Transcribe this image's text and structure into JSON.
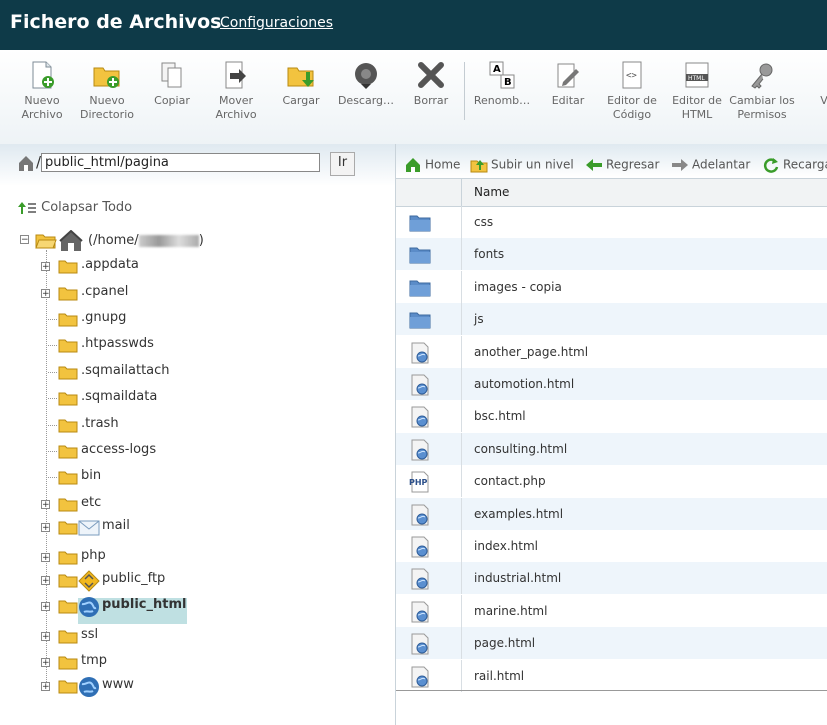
{
  "header": {
    "title": "Fichero de Archivos",
    "config_link": "Configuraciones"
  },
  "toolbar": {
    "new_file": "Nuevo Archivo",
    "new_dir": "Nuevo Directorio",
    "copy": "Copiar",
    "move": "Mover Archivo",
    "upload": "Cargar",
    "download": "Descarg…",
    "delete": "Borrar",
    "rename": "Renomb…",
    "edit": "Editar",
    "code_editor": "Editor de Código",
    "html_editor": "Editor de HTML",
    "permissions": "Cambiar los Permisos",
    "view": "Ve"
  },
  "path": {
    "value": "public_html/pagina",
    "go_label": "Ir"
  },
  "tree": {
    "collapse_label": "Colapsar Todo",
    "root_label": "(/home/",
    "root_label_end": ")",
    "items": [
      {
        "label": ".appdata"
      },
      {
        "label": ".cpanel"
      },
      {
        "label": ".gnupg"
      },
      {
        "label": ".htpasswds"
      },
      {
        "label": ".sqmailattach"
      },
      {
        "label": ".sqmaildata"
      },
      {
        "label": ".trash"
      },
      {
        "label": "access-logs"
      },
      {
        "label": "bin"
      },
      {
        "label": "etc"
      },
      {
        "label": "mail"
      },
      {
        "label": "php"
      },
      {
        "label": "public_ftp"
      },
      {
        "label": "public_html"
      },
      {
        "label": "ssl"
      },
      {
        "label": "tmp"
      },
      {
        "label": "www"
      }
    ]
  },
  "nav": {
    "home": "Home",
    "up": "Subir un nivel",
    "back": "Regresar",
    "forward": "Adelantar",
    "reload": "Recarga"
  },
  "files": {
    "header_name": "Name",
    "rows": [
      {
        "name": "css",
        "icon": "folder-icon"
      },
      {
        "name": "fonts",
        "icon": "folder-icon"
      },
      {
        "name": "images - copia",
        "icon": "folder-icon"
      },
      {
        "name": "js",
        "icon": "folder-icon"
      },
      {
        "name": "another_page.html",
        "icon": "html-file-icon"
      },
      {
        "name": "automotion.html",
        "icon": "html-file-icon"
      },
      {
        "name": "bsc.html",
        "icon": "html-file-icon"
      },
      {
        "name": "consulting.html",
        "icon": "html-file-icon"
      },
      {
        "name": "contact.php",
        "icon": "php-file-icon"
      },
      {
        "name": "examples.html",
        "icon": "html-file-icon"
      },
      {
        "name": "index.html",
        "icon": "html-file-icon"
      },
      {
        "name": "industrial.html",
        "icon": "html-file-icon"
      },
      {
        "name": "marine.html",
        "icon": "html-file-icon"
      },
      {
        "name": "page.html",
        "icon": "html-file-icon"
      },
      {
        "name": "rail.html",
        "icon": "html-file-icon"
      }
    ]
  },
  "colors": {
    "header_bg": "#0e3a48",
    "folder": "#f2c33f",
    "selected": "#bfe0e2",
    "alt_row": "#eef5fb"
  }
}
